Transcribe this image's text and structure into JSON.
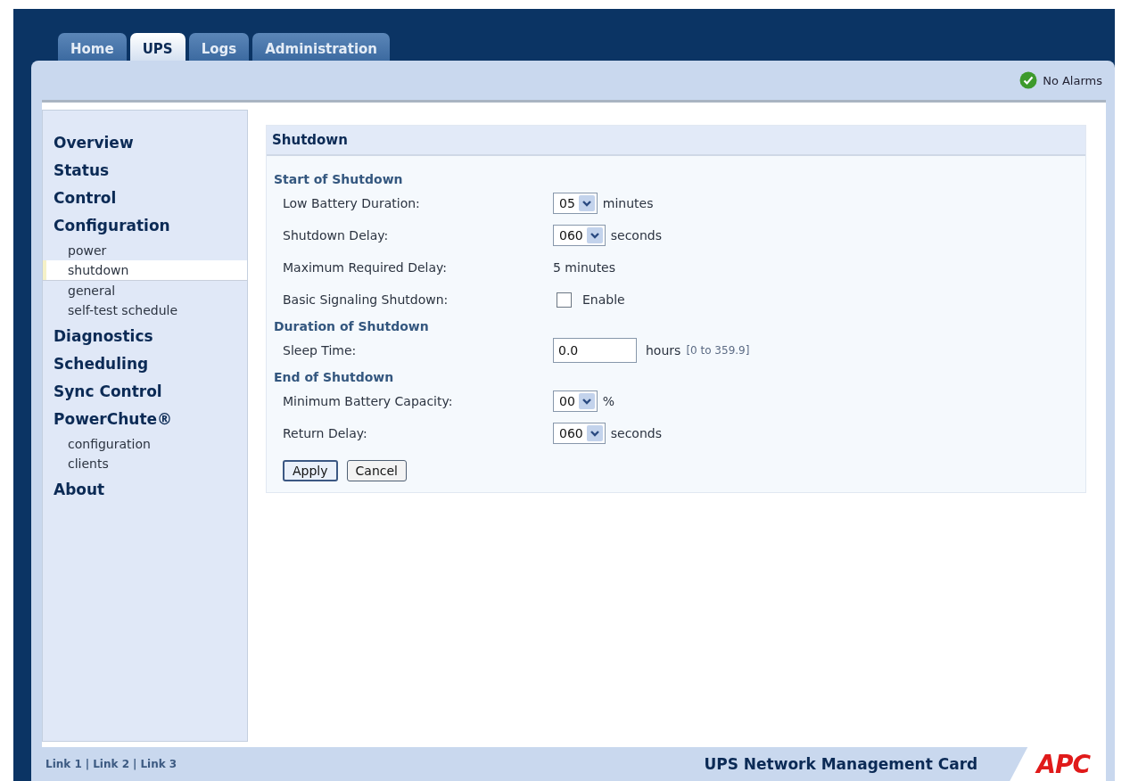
{
  "tabs": [
    {
      "label": "Home",
      "selected": false
    },
    {
      "label": "UPS",
      "selected": true
    },
    {
      "label": "Logs",
      "selected": false
    },
    {
      "label": "Administration",
      "selected": false
    }
  ],
  "alarm_status": {
    "label": "No Alarms"
  },
  "sidebar": {
    "items": [
      {
        "label": "Overview",
        "selected": false
      },
      {
        "label": "Status",
        "selected": false
      },
      {
        "label": "Control",
        "selected": false
      },
      {
        "label": "Configuration",
        "selected": false,
        "children": [
          {
            "label": "power",
            "selected": false
          },
          {
            "label": "shutdown",
            "selected": true
          },
          {
            "label": "general",
            "selected": false
          },
          {
            "label": "self-test schedule",
            "selected": false
          }
        ]
      },
      {
        "label": "Diagnostics",
        "selected": false
      },
      {
        "label": "Scheduling",
        "selected": false
      },
      {
        "label": "Sync Control",
        "selected": false
      },
      {
        "label": "PowerChute®",
        "selected": false,
        "children": [
          {
            "label": "configuration",
            "selected": false
          },
          {
            "label": "clients",
            "selected": false
          }
        ]
      },
      {
        "label": "About",
        "selected": false
      }
    ]
  },
  "panel": {
    "title": "Shutdown",
    "sections": [
      {
        "heading": "Start of Shutdown",
        "rows": [
          {
            "kind": "select",
            "label": "Low Battery Duration:",
            "value": "05",
            "unit": "minutes"
          },
          {
            "kind": "select",
            "label": "Shutdown Delay:",
            "value": "060",
            "unit": "seconds"
          },
          {
            "kind": "static",
            "label": "Maximum Required Delay:",
            "value": "5 minutes"
          },
          {
            "kind": "checkbox",
            "label": "Basic Signaling Shutdown:",
            "checked": false,
            "option": "Enable"
          }
        ]
      },
      {
        "heading": "Duration of Shutdown",
        "rows": [
          {
            "kind": "text",
            "label": "Sleep Time:",
            "value": "0.0",
            "unit": "hours",
            "hint": "[0 to 359.9]"
          }
        ]
      },
      {
        "heading": "End of Shutdown",
        "rows": [
          {
            "kind": "select",
            "label": "Minimum Battery Capacity:",
            "value": "00",
            "unit": "%"
          },
          {
            "kind": "select",
            "label": "Return Delay:",
            "value": "060",
            "unit": "seconds"
          }
        ]
      }
    ],
    "buttons": [
      {
        "label": "Apply",
        "default": true
      },
      {
        "label": "Cancel",
        "default": false
      }
    ]
  },
  "footer": {
    "links": [
      "Link 1",
      "Link 2",
      "Link 3"
    ],
    "separator": "|",
    "product": "UPS Network Management Card",
    "logo": "APC"
  }
}
